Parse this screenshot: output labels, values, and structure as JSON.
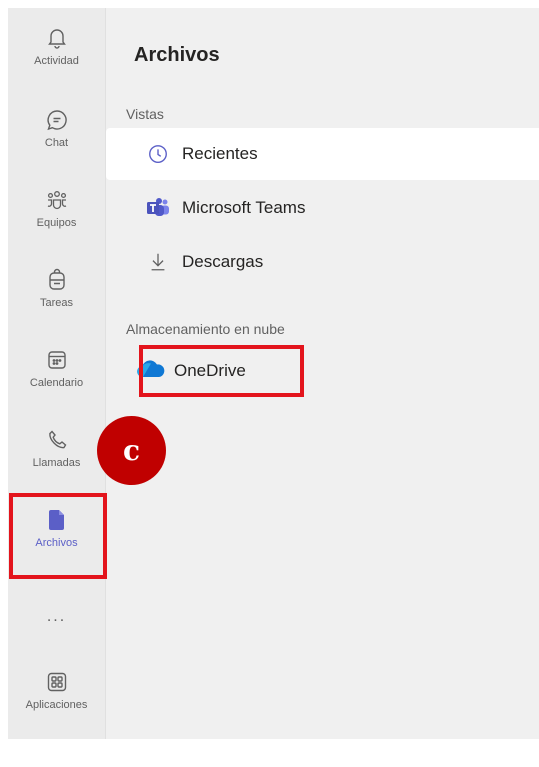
{
  "rail": {
    "items": [
      {
        "label": "Actividad",
        "icon": "bell-icon"
      },
      {
        "label": "Chat",
        "icon": "chat-icon"
      },
      {
        "label": "Equipos",
        "icon": "teams-people-icon"
      },
      {
        "label": "Tareas",
        "icon": "tasks-backpack-icon"
      },
      {
        "label": "Calendario",
        "icon": "calendar-icon"
      },
      {
        "label": "Llamadas",
        "icon": "phone-icon"
      },
      {
        "label": "Archivos",
        "icon": "file-icon",
        "active": true
      },
      {
        "label": "Aplicaciones",
        "icon": "apps-icon"
      }
    ],
    "more": "..."
  },
  "pane": {
    "title": "Archivos",
    "views_label": "Vistas",
    "views": [
      {
        "label": "Recientes",
        "icon": "clock-icon",
        "selected": true
      },
      {
        "label": "Microsoft Teams",
        "icon": "microsoft-teams-icon"
      },
      {
        "label": "Descargas",
        "icon": "download-icon"
      }
    ],
    "cloud_label": "Almacenamiento en nube",
    "cloud": [
      {
        "label": "OneDrive",
        "icon": "onedrive-cloud-icon"
      }
    ]
  },
  "annotation": {
    "badge": "c"
  },
  "colors": {
    "accent": "#5b5fc7",
    "highlight": "#e3141c",
    "badge": "#c00000",
    "onedrive": "#0f78d4"
  }
}
